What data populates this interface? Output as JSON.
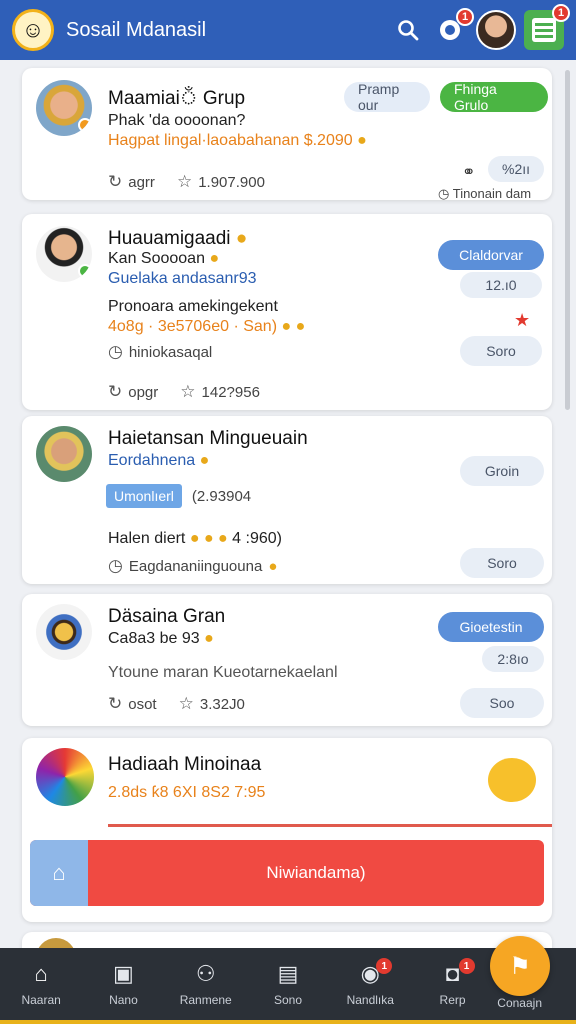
{
  "header": {
    "title": "Sosail Mdanasil",
    "logo_icon": "mascot-logo-icon",
    "notification_badge": "1",
    "menu_badge": "1"
  },
  "cards": [
    {
      "title": "Maamiaiঁ Grup",
      "line1": "Phak 'da oooonan?",
      "line2": "Hagpat lingal·laoabahanan $.2090",
      "meta_label": "agrr",
      "meta_value": "1.907.900",
      "button1": "Pramp our",
      "button2": "Fhinga Grulo",
      "side_count": "%2ıı",
      "side_label": "Tinonain dam"
    },
    {
      "title": "Huauamigaadi",
      "line1": "Kan Sooooan",
      "line2": "Guelaka andasanr93",
      "line3": "Pronoara amekingekent",
      "line4": "4o8g · 3e5706e0 · San)",
      "status": "hiniokasaqal",
      "meta_label": "opgr",
      "meta_value": "142?956",
      "button1": "Claldorvar",
      "side_count": "12.ı0",
      "side_button": "Soro"
    },
    {
      "title": "Haietansan Mingueuain",
      "line1": "Eordahnena",
      "tag": "Umonlıerl",
      "tag_value": "(2.93904",
      "line2": "Halen diert",
      "line2_value": "4 :960)",
      "status": "Eagdananiinguouna",
      "button1": "Groin",
      "button2": "Soro"
    },
    {
      "title": "Däsaina Gran",
      "line1": "Ca8a3 be 93",
      "line2": "Ytoune maran Kueotarnekaelanl",
      "meta_label": "osot",
      "meta_value": "3.32J0",
      "button1": "Gioetestin",
      "side_count": "2:8ıo",
      "side_button": "Soo"
    },
    {
      "title": "Hadiaah Minoinaa",
      "line1": "2.8ds ƙ8 6XI 8S2 7:95",
      "action_label": "Niwiandama)"
    }
  ],
  "bottom_nav": [
    {
      "label": "Naaran",
      "icon": "home-icon",
      "badge": ""
    },
    {
      "label": "Nano",
      "icon": "tv-icon",
      "badge": ""
    },
    {
      "label": "Ranmene",
      "icon": "people-icon",
      "badge": ""
    },
    {
      "label": "Sono",
      "icon": "image-icon",
      "badge": ""
    },
    {
      "label": "Nandlıka",
      "icon": "profile-icon",
      "badge": "1"
    },
    {
      "label": "Rerp",
      "icon": "message-icon",
      "badge": "1"
    }
  ],
  "fab": {
    "label": "Conaajn",
    "icon": "map-icon"
  },
  "colors": {
    "header": "#2f5fb8",
    "primary_blue": "#5b8fd9",
    "green": "#4bb543",
    "red": "#f04a42",
    "orange": "#f6a623"
  }
}
